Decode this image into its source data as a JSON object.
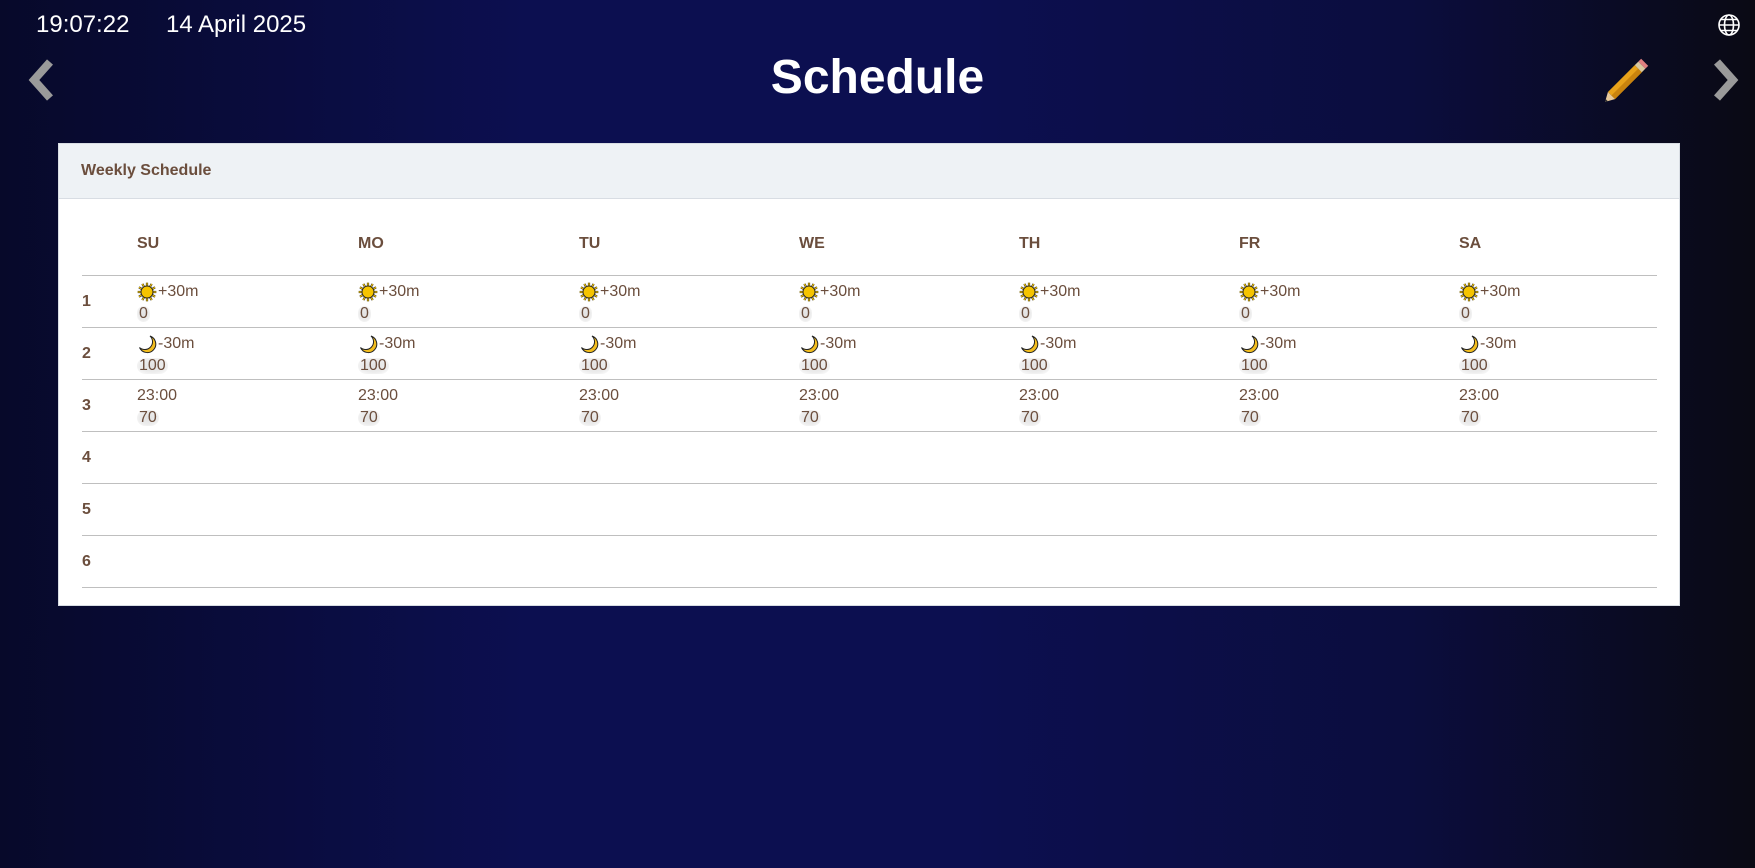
{
  "status": {
    "time": "19:07:22",
    "date": "14 April 2025"
  },
  "header": {
    "title": "Schedule"
  },
  "icons": {
    "globe": "globe-icon",
    "prev": "chevron-left-icon",
    "next": "chevron-right-icon",
    "edit": "pencil-icon",
    "sun": "sun-icon",
    "moon": "moon-icon"
  },
  "card": {
    "title": "Weekly Schedule"
  },
  "days": [
    "SU",
    "MO",
    "TU",
    "WE",
    "TH",
    "FR",
    "SA"
  ],
  "rows": [
    {
      "num": "1",
      "trigger": "+30m",
      "icon": "sun",
      "value": "0"
    },
    {
      "num": "2",
      "trigger": "-30m",
      "icon": "moon",
      "value": "100"
    },
    {
      "num": "3",
      "trigger": "23:00",
      "icon": "",
      "value": "70"
    },
    {
      "num": "4",
      "trigger": "",
      "icon": "",
      "value": ""
    },
    {
      "num": "5",
      "trigger": "",
      "icon": "",
      "value": ""
    },
    {
      "num": "6",
      "trigger": "",
      "icon": "",
      "value": ""
    }
  ],
  "colors": {
    "accent_text": "#6b4e3d",
    "sun": "#f5c400",
    "moon": "#f2bd1e",
    "pencil": "#e8a21a"
  }
}
